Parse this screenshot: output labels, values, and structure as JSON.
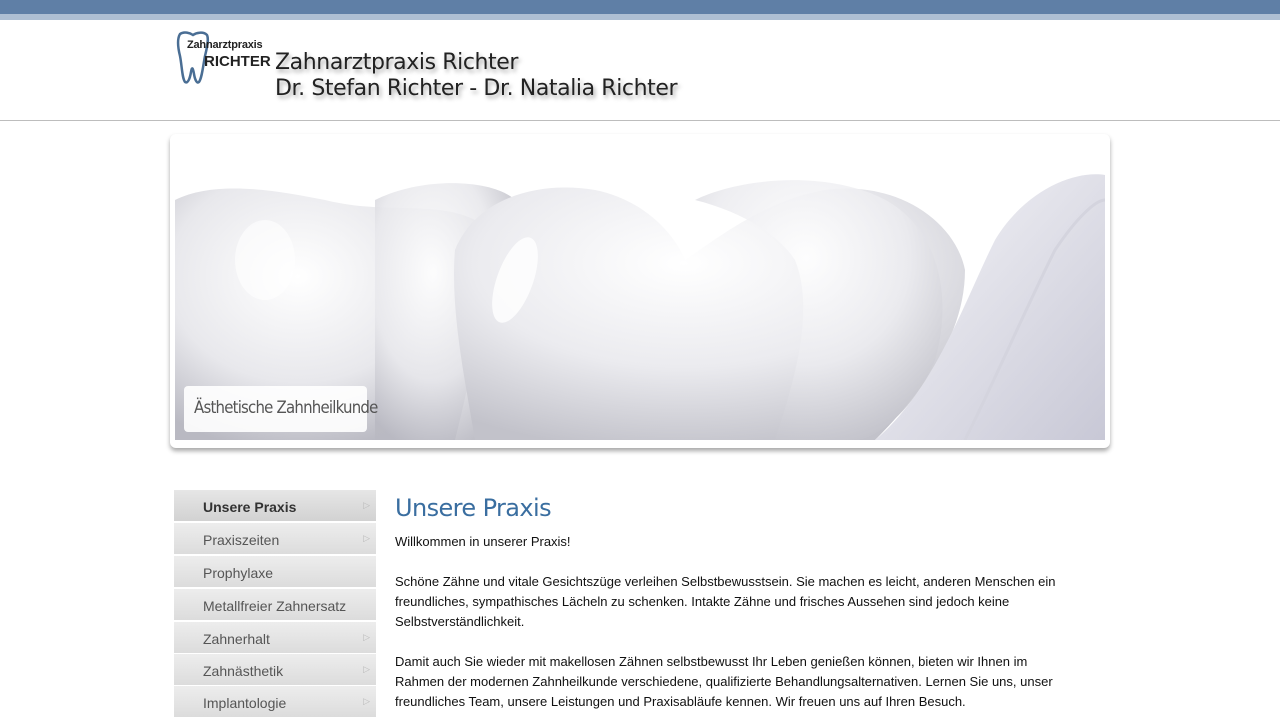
{
  "logo": {
    "line1": "Zahnarztpraxis",
    "line2": "RICHTER"
  },
  "header": {
    "title_line1": "Zahnarztpraxis Richter",
    "title_line2": "Dr. Stefan Richter - Dr. Natalia Richter"
  },
  "banner": {
    "caption": "Ästhetische Zahnheilkunde"
  },
  "sidebar": {
    "items": [
      {
        "label": "Unsere Praxis",
        "active": true,
        "has_submenu": true
      },
      {
        "label": "Praxiszeiten",
        "active": false,
        "has_submenu": true
      },
      {
        "label": "Prophylaxe",
        "active": false,
        "has_submenu": false
      },
      {
        "label": "Metallfreier Zahnersatz",
        "active": false,
        "has_submenu": false
      },
      {
        "label": "Zahnerhalt",
        "active": false,
        "has_submenu": true
      },
      {
        "label": "Zahnästhetik",
        "active": false,
        "has_submenu": true
      },
      {
        "label": "Implantologie",
        "active": false,
        "has_submenu": true
      }
    ],
    "arrow_icon": "triangle-right-icon"
  },
  "main": {
    "heading": "Unsere Praxis",
    "paragraphs": [
      "Willkommen in unserer Praxis!",
      "Schöne Zähne und vitale Gesichtszüge verleihen Selbstbewusstsein. Sie machen es leicht, anderen Menschen ein freundliches, sympathisches Lächeln zu schenken. Intakte Zähne und frisches Aussehen sind jedoch keine Selbstverständlichkeit.",
      "Damit auch Sie wieder mit makellosen Zähnen selbstbewusst Ihr Leben genießen können, bieten wir Ihnen im Rahmen der modernen Zahnheilkunde verschiedene, qualifizierte Behandlungsalternativen. Lernen Sie uns, unser freundliches Team, unsere Leistungen und Praxisabläufe kennen. Wir freuen uns auf Ihren Besuch."
    ]
  },
  "colors": {
    "topbar": "#5f7fa6",
    "heading": "#3a6ea0"
  }
}
